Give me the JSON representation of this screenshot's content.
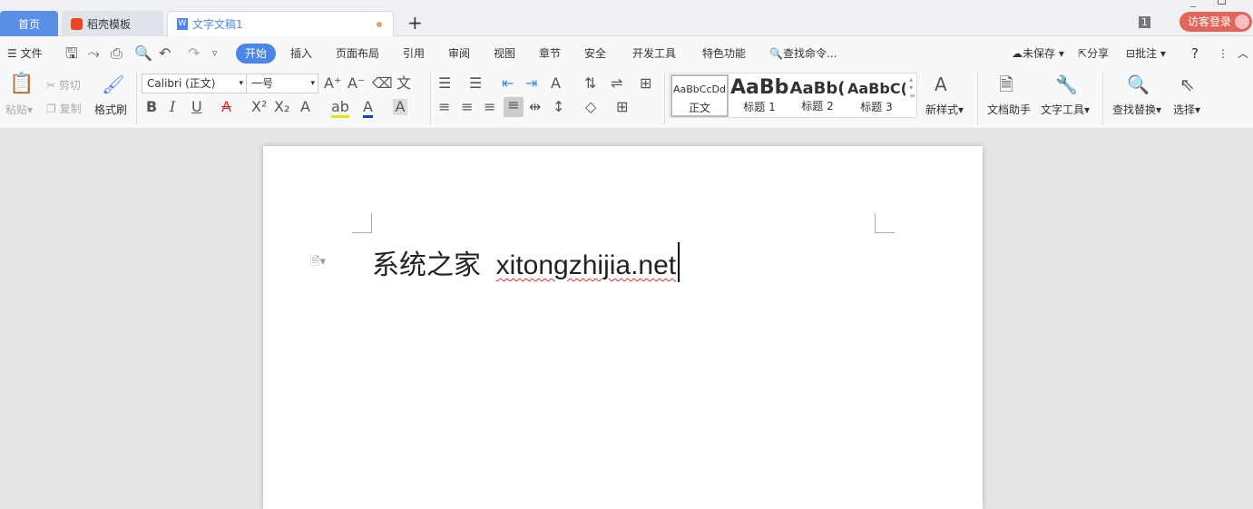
{
  "tabs": {
    "home": "首页",
    "template": "稻壳模板",
    "doc": "文字文稿1",
    "new": "+"
  },
  "window": {
    "count": "1",
    "login": "访客登录"
  },
  "menu": {
    "file": "文件",
    "items": [
      "开始",
      "插入",
      "页面布局",
      "引用",
      "审阅",
      "视图",
      "章节",
      "安全",
      "开发工具",
      "特色功能"
    ],
    "search": "查找命令...",
    "unsaved": "未保存",
    "share": "分享",
    "comment": "批注",
    "help": "?"
  },
  "clipboard": {
    "paste": "粘贴",
    "cut": "剪切",
    "copy": "复制",
    "format_painter": "格式刷"
  },
  "font": {
    "name": "Calibri (正文)",
    "size": "一号"
  },
  "styles": [
    {
      "preview": "AaBbCcDd",
      "label": "正文"
    },
    {
      "preview": "AaBb",
      "label": "标题 1"
    },
    {
      "preview": "AaBb(",
      "label": "标题 2"
    },
    {
      "preview": "AaBbC(",
      "label": "标题 3"
    }
  ],
  "tools": {
    "new_style": "新样式",
    "doc_helper": "文档助手",
    "text_tools": "文字工具",
    "find_replace": "查找替换",
    "select": "选择"
  },
  "document": {
    "text_cn": "系统之家",
    "text_en": "xitongzhijia.net"
  },
  "colors": {
    "accent": "#4a86e8",
    "login": "#e0655a"
  }
}
